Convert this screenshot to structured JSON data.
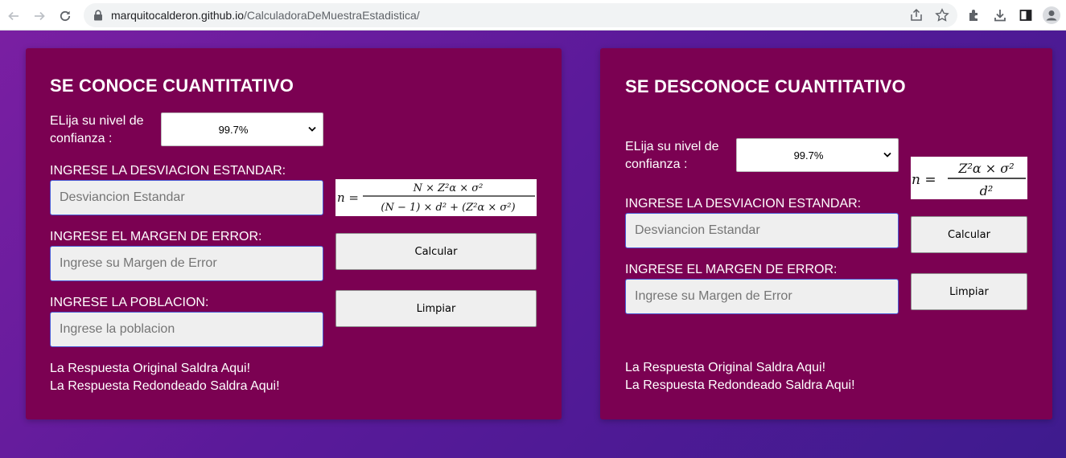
{
  "browser": {
    "url_host": "marquitocalderon.github.io",
    "url_path": "/CalculadoraDeMuestraEstadistica/"
  },
  "left_panel": {
    "title": "SE CONOCE CUANTITATIVO",
    "confidence_label_line1": "ELija su nivel de",
    "confidence_label_line2": "confianza :",
    "confidence_selected": "99.7%",
    "std_label": "INGRESE LA DESVIACION ESTANDAR:",
    "std_placeholder": "Desviancion Estandar",
    "margin_label": "INGRESE EL MARGEN DE ERROR:",
    "margin_placeholder": "Ingrese su Margen de Error",
    "population_label": "INGRESE LA POBLACION:",
    "population_placeholder": "Ingrese la poblacion",
    "calculate_button": "Calcular",
    "clear_button": "Limpiar",
    "result_original": "La Respuesta Original Saldra Aqui!",
    "result_rounded": "La Respuesta Redondeado Saldra Aqui!"
  },
  "right_panel": {
    "title": "SE DESCONOCE CUANTITATIVO",
    "confidence_label_line1": "ELija su nivel de",
    "confidence_label_line2": "confianza :",
    "confidence_selected": "99.7%",
    "std_label": "INGRESE LA DESVIACION ESTANDAR:",
    "std_placeholder": "Desviancion Estandar",
    "margin_label": "INGRESE EL MARGEN DE ERROR:",
    "margin_placeholder": "Ingrese su Margen de Error",
    "calculate_button": "Calcular",
    "clear_button": "Limpiar",
    "result_original": "La Respuesta Original Saldra Aqui!",
    "result_rounded": "La Respuesta Redondeado Saldra Aqui!"
  },
  "icons": [
    "back-icon",
    "forward-icon",
    "reload-icon",
    "lock-icon",
    "share-icon",
    "star-icon",
    "extensions-icon",
    "download-icon",
    "side-panel-icon",
    "profile-icon",
    "chevron-down-icon"
  ]
}
